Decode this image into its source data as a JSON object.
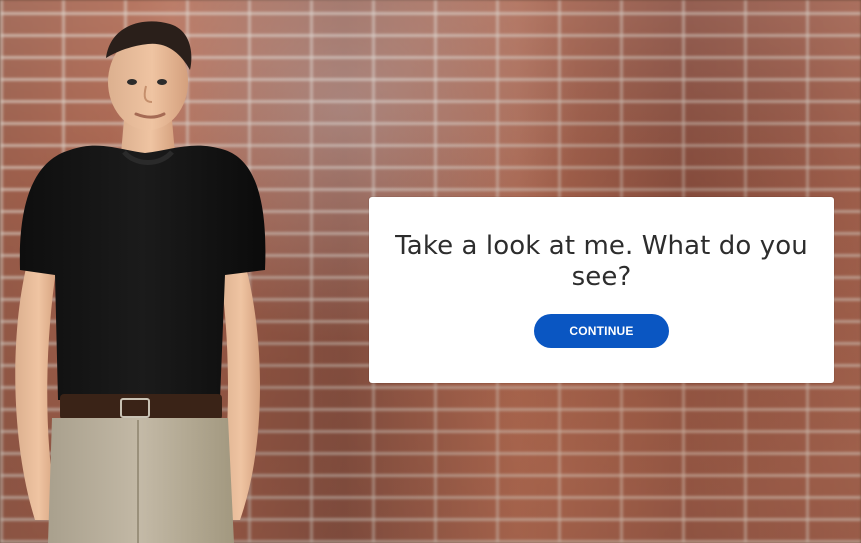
{
  "scene": {
    "background": "brick-wall",
    "character": "young-man-black-tshirt"
  },
  "dialog": {
    "message": "Take a look at me. What do you see?",
    "continue_label": "CONTINUE"
  },
  "colors": {
    "button_background": "#0A56C2",
    "dialog_background": "#FFFFFF",
    "text": "#2D2D2D"
  }
}
